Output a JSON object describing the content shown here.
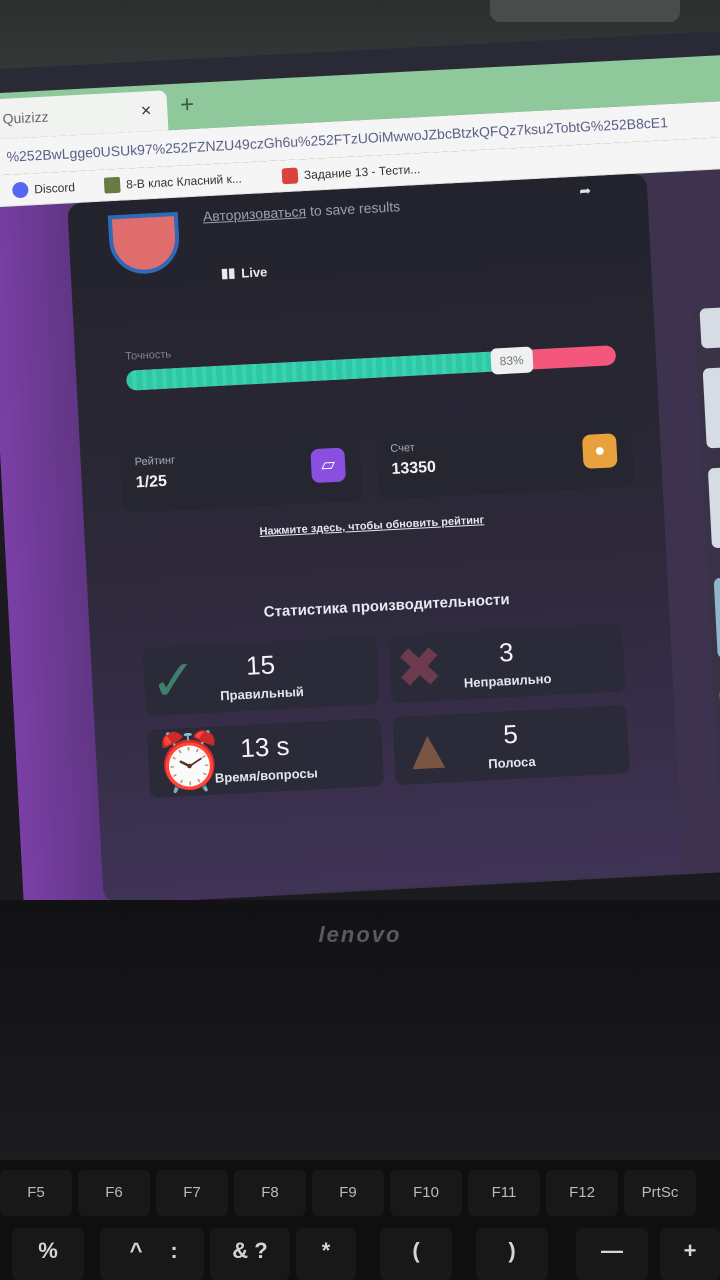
{
  "browser": {
    "tab_title": "Quizizz",
    "tab_close": "×",
    "new_tab": "+",
    "url": "%252BwLgge0USUk97%252FZNZU49czGh6u%252FTzUOiMwwoJZbcBtzkQFQz7ksu2TobtG%252B8cE1",
    "bookmarks": [
      {
        "label": "Discord",
        "icon": "discord-icon"
      },
      {
        "label": "8-В клас Класний к...",
        "icon": "classroom-icon"
      },
      {
        "label": "Задание 13 - Тести...",
        "icon": "test-icon"
      }
    ]
  },
  "result": {
    "auth_link": "Авторизоваться",
    "auth_rest": " to save results",
    "live_label": "Live",
    "accuracy_label": "Точность",
    "accuracy_percent": 83,
    "accuracy_text": "83%",
    "rating_label": "Рейтинг",
    "rating_value": "1/25",
    "score_label": "Счет",
    "score_value": "13350",
    "refresh_link": "Нажмите здесь, чтобы обновить рейтинг"
  },
  "stats": {
    "title": "Статистика производительности",
    "items": [
      {
        "number": "15",
        "label": "Правильный",
        "icon": "check-icon"
      },
      {
        "number": "3",
        "label": "Неправильно",
        "icon": "cross-icon"
      },
      {
        "number": "13 s",
        "label": "Время/вопросы",
        "icon": "timer-icon"
      },
      {
        "number": "5",
        "label": "Полоса",
        "icon": "fire-icon"
      }
    ]
  },
  "laptop": {
    "brand": "lenovo",
    "fkeys": [
      "F5",
      "F6",
      "F7",
      "F8",
      "F9",
      "F10",
      "F11",
      "F12",
      "PrtSc"
    ],
    "symbol_keys": [
      "%",
      "^",
      ":",
      "& ?",
      "*",
      "(",
      ")",
      "—",
      "+"
    ]
  },
  "colors": {
    "correct_green": "#2fc7a5",
    "incorrect_pink": "#f3587c",
    "rating_icon_purple": "#8a4fe0",
    "score_icon_orange": "#e8a13c"
  }
}
